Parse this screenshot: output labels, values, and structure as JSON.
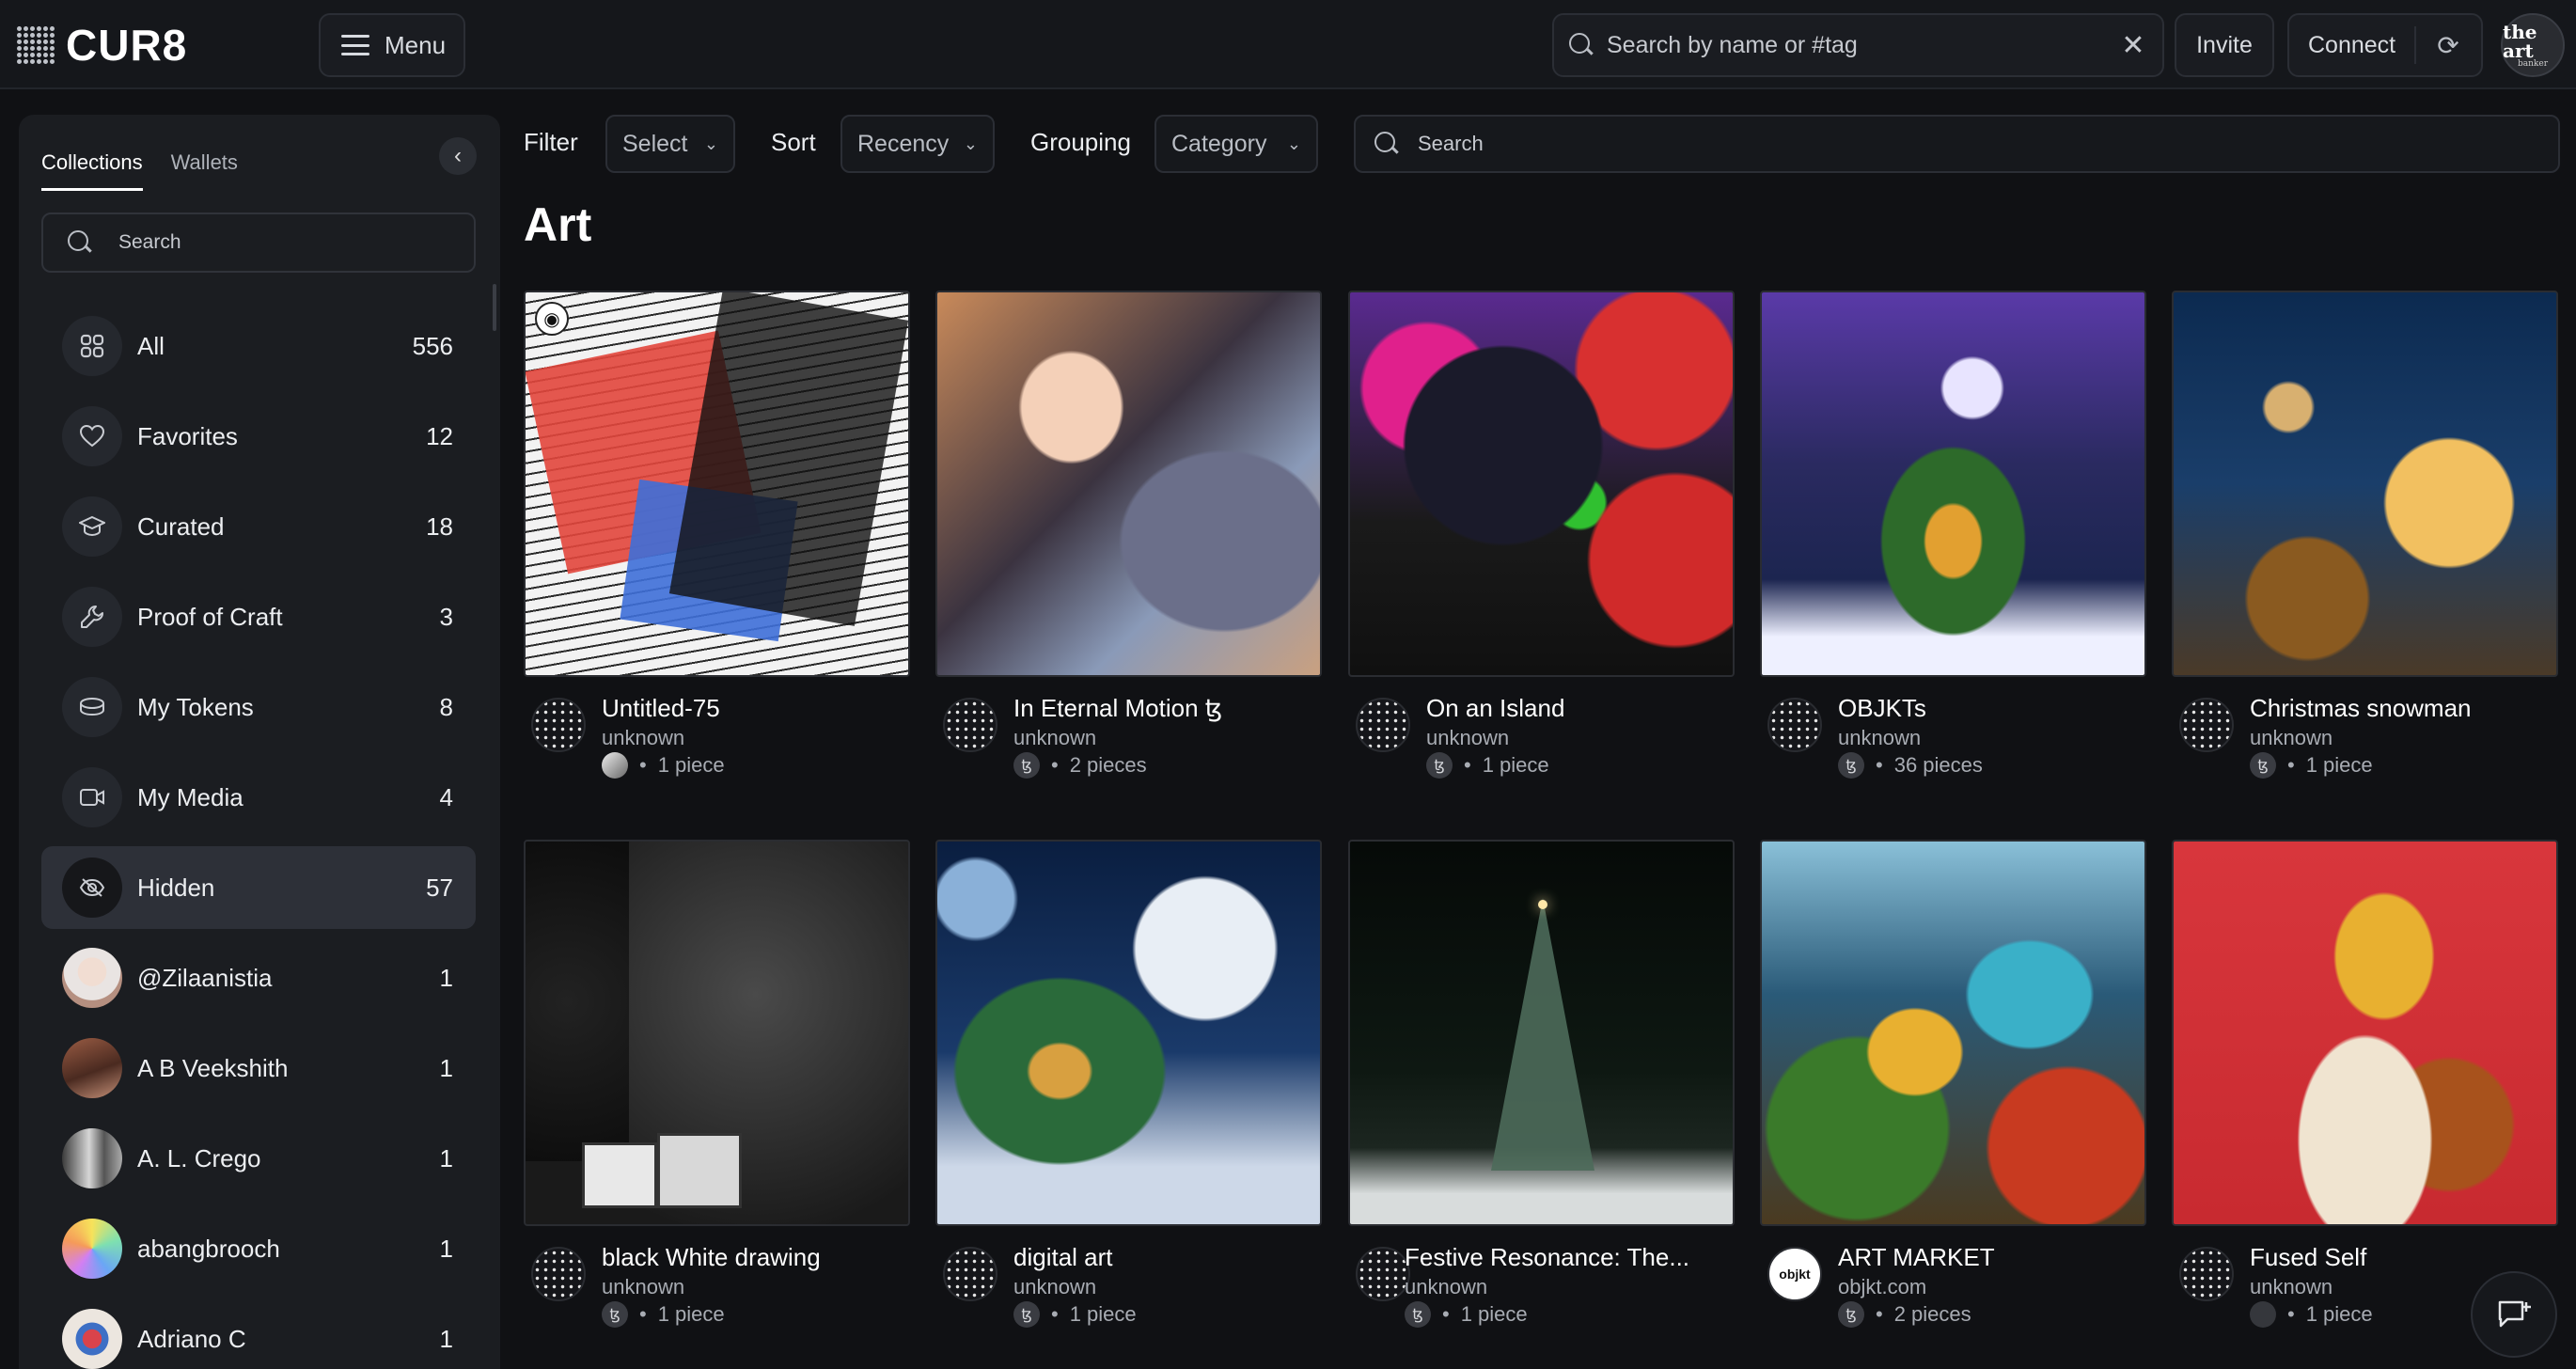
{
  "app": {
    "logo": "CUR8",
    "menu_label": "Menu"
  },
  "header": {
    "search_placeholder": "Search by name or #tag",
    "clear_icon": "✕",
    "invite_label": "Invite",
    "connect_label": "Connect",
    "avatar_text_top": "the art",
    "avatar_text_bottom": "banker"
  },
  "sidebar": {
    "tabs": [
      {
        "label": "Collections",
        "active": true
      },
      {
        "label": "Wallets",
        "active": false
      }
    ],
    "search_placeholder": "Search",
    "items": [
      {
        "label": "All",
        "count": "556",
        "icon": "grid-icon"
      },
      {
        "label": "Favorites",
        "count": "12",
        "icon": "heart-icon"
      },
      {
        "label": "Curated",
        "count": "18",
        "icon": "graduation-cap-icon"
      },
      {
        "label": "Proof of Craft",
        "count": "3",
        "icon": "wrench-icon"
      },
      {
        "label": "My Tokens",
        "count": "8",
        "icon": "coins-icon"
      },
      {
        "label": "My Media",
        "count": "4",
        "icon": "video-icon"
      },
      {
        "label": "Hidden",
        "count": "57",
        "icon": "eye-off-icon",
        "active": true
      },
      {
        "label": "@Zilaanistia",
        "count": "1",
        "avatar": "#c9b8b0"
      },
      {
        "label": "A B Veekshith",
        "count": "1",
        "avatar": "#7a4a3a"
      },
      {
        "label": "A. L. Crego",
        "count": "1",
        "avatar": "#8a8a8a"
      },
      {
        "label": "abangbrooch",
        "count": "1",
        "avatar": "#7fd0a8"
      },
      {
        "label": "Adriano C",
        "count": "1",
        "avatar": "#e9e3dc"
      }
    ]
  },
  "toolbar": {
    "filter_label": "Filter",
    "filter_value": "Select",
    "sort_label": "Sort",
    "sort_value": "Recency",
    "grouping_label": "Grouping",
    "grouping_value": "Category",
    "search_placeholder": "Search"
  },
  "page_title": "Art",
  "cards": [
    {
      "title": "Untitled-75",
      "creator": "unknown",
      "pieces": "1 piece"
    },
    {
      "title": "In Eternal Motion ꜩ",
      "creator": "unknown",
      "pieces": "2 pieces"
    },
    {
      "title": "On an Island",
      "creator": "unknown",
      "pieces": "1 piece"
    },
    {
      "title": "OBJKTs",
      "creator": "unknown",
      "pieces": "36 pieces"
    },
    {
      "title": "Christmas snowman",
      "creator": "unknown",
      "pieces": "1 piece"
    },
    {
      "title": "black White drawing",
      "creator": "unknown",
      "pieces": "1 piece"
    },
    {
      "title": "digital art",
      "creator": "unknown",
      "pieces": "1 piece"
    },
    {
      "title": "Festive Resonance: The...",
      "creator": "unknown",
      "pieces": "1 piece"
    },
    {
      "title": "ART MARKET",
      "creator": "objkt.com",
      "pieces": "2 pieces",
      "creator_logo": "objkt"
    },
    {
      "title": "Fused Self",
      "creator": "unknown",
      "pieces": "1 piece"
    }
  ],
  "bullet": "•",
  "tez_symbol": "ꜩ"
}
